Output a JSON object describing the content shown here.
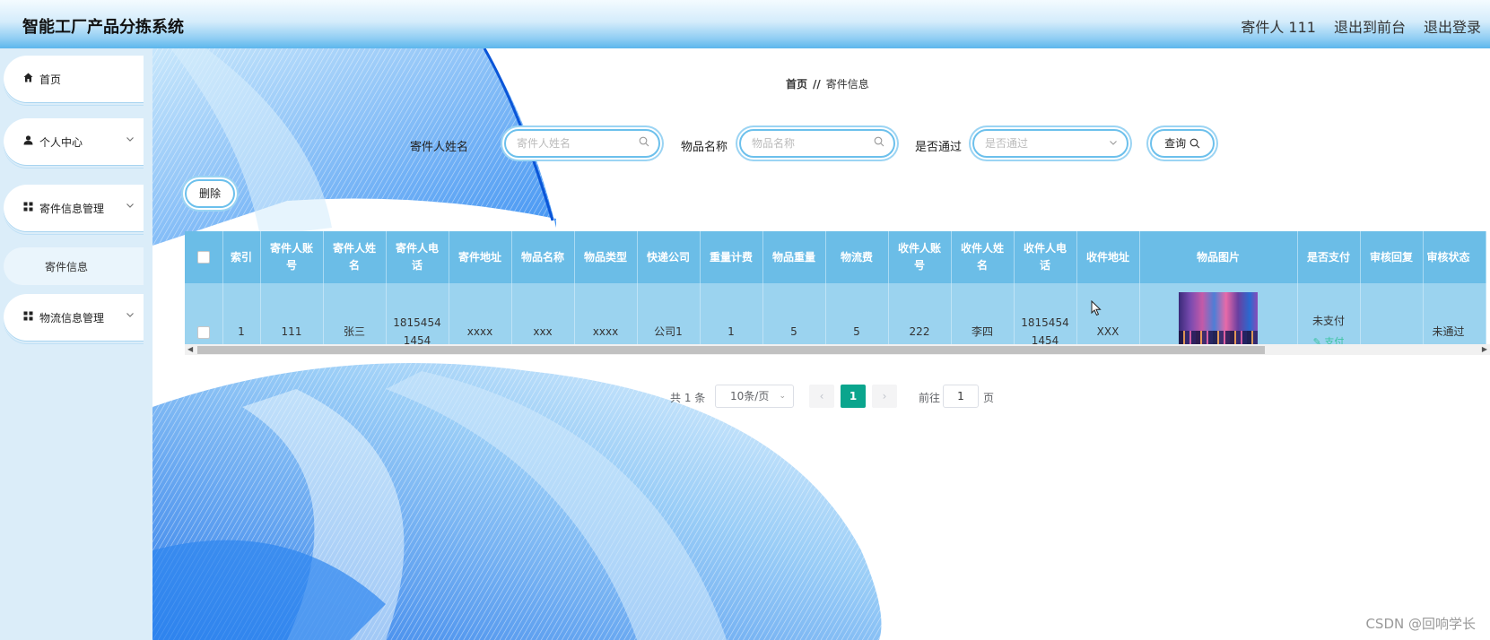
{
  "header": {
    "app_title": "智能工厂产品分拣系统",
    "user_label": "寄件人 111",
    "front_label": "退出到前台",
    "logout_label": "退出登录"
  },
  "sidebar": {
    "items": [
      {
        "label": "首页",
        "icon": "home-icon"
      },
      {
        "label": "个人中心",
        "icon": "user-icon"
      },
      {
        "label": "寄件信息管理",
        "icon": "grid-icon"
      },
      {
        "label": "寄件信息",
        "icon": ""
      },
      {
        "label": "物流信息管理",
        "icon": "grid-icon"
      }
    ]
  },
  "breadcrumb": {
    "home": "首页",
    "separator": "//",
    "current": "寄件信息"
  },
  "search": {
    "sender_name_label": "寄件人姓名",
    "sender_name_placeholder": "寄件人姓名",
    "item_name_label": "物品名称",
    "item_name_placeholder": "物品名称",
    "passed_label": "是否通过",
    "passed_placeholder": "是否通过",
    "query_label": "查询"
  },
  "toolbar": {
    "delete_label": "删除"
  },
  "table": {
    "headers": [
      "索引",
      "寄件人账号",
      "寄件人姓名",
      "寄件人电话",
      "寄件地址",
      "物品名称",
      "物品类型",
      "快递公司",
      "重量计费",
      "物品重量",
      "物流费",
      "收件人账号",
      "收件人姓名",
      "收件人电话",
      "收件地址",
      "物品图片",
      "是否支付",
      "审核回复",
      "审核状态"
    ],
    "header_lines": [
      [
        "索引"
      ],
      [
        "寄件人账",
        "号"
      ],
      [
        "寄件人姓",
        "名"
      ],
      [
        "寄件人电",
        "话"
      ],
      [
        "寄件地址"
      ],
      [
        "物品名称"
      ],
      [
        "物品类型"
      ],
      [
        "快递公司"
      ],
      [
        "重量计费"
      ],
      [
        "物品重量"
      ],
      [
        "物流费"
      ],
      [
        "收件人账",
        "号"
      ],
      [
        "收件人姓",
        "名"
      ],
      [
        "收件人电",
        "话"
      ],
      [
        "收件地址"
      ],
      [
        "物品图片"
      ],
      [
        "是否支付"
      ],
      [
        "审核回复"
      ],
      [
        "审核状态"
      ]
    ],
    "rows": [
      {
        "index": "1",
        "sender_account": "111",
        "sender_name": "张三",
        "sender_phone_1": "1815454",
        "sender_phone_2": "1454",
        "sender_address": "xxxx",
        "item_name": "xxx",
        "item_type": "xxxx",
        "courier": "公司1",
        "weight_billing": "1",
        "item_weight": "5",
        "logistics_fee": "5",
        "receiver_account": "222",
        "receiver_name": "李四",
        "receiver_phone_1": "1815454",
        "receiver_phone_2": "1454",
        "receiver_address": "XXX",
        "paid_status": "未支付",
        "pay_link": "支付",
        "review_reply": "",
        "review_status": "未通过"
      }
    ]
  },
  "pagination": {
    "total": "共 1 条",
    "page_size": "10条/页",
    "current_page": "1",
    "goto_label": "前往",
    "goto_value": "1",
    "page_suffix": "页"
  },
  "watermark": "CSDN @回响学长",
  "colors": {
    "header_gradient_end": "#5cb6ec",
    "sidebar_bg": "#dbedf9",
    "table_header": "#6bbde7",
    "table_row": "#9bd3ef",
    "active_page": "#0aa58d",
    "pay_link": "#3cc3a0"
  }
}
